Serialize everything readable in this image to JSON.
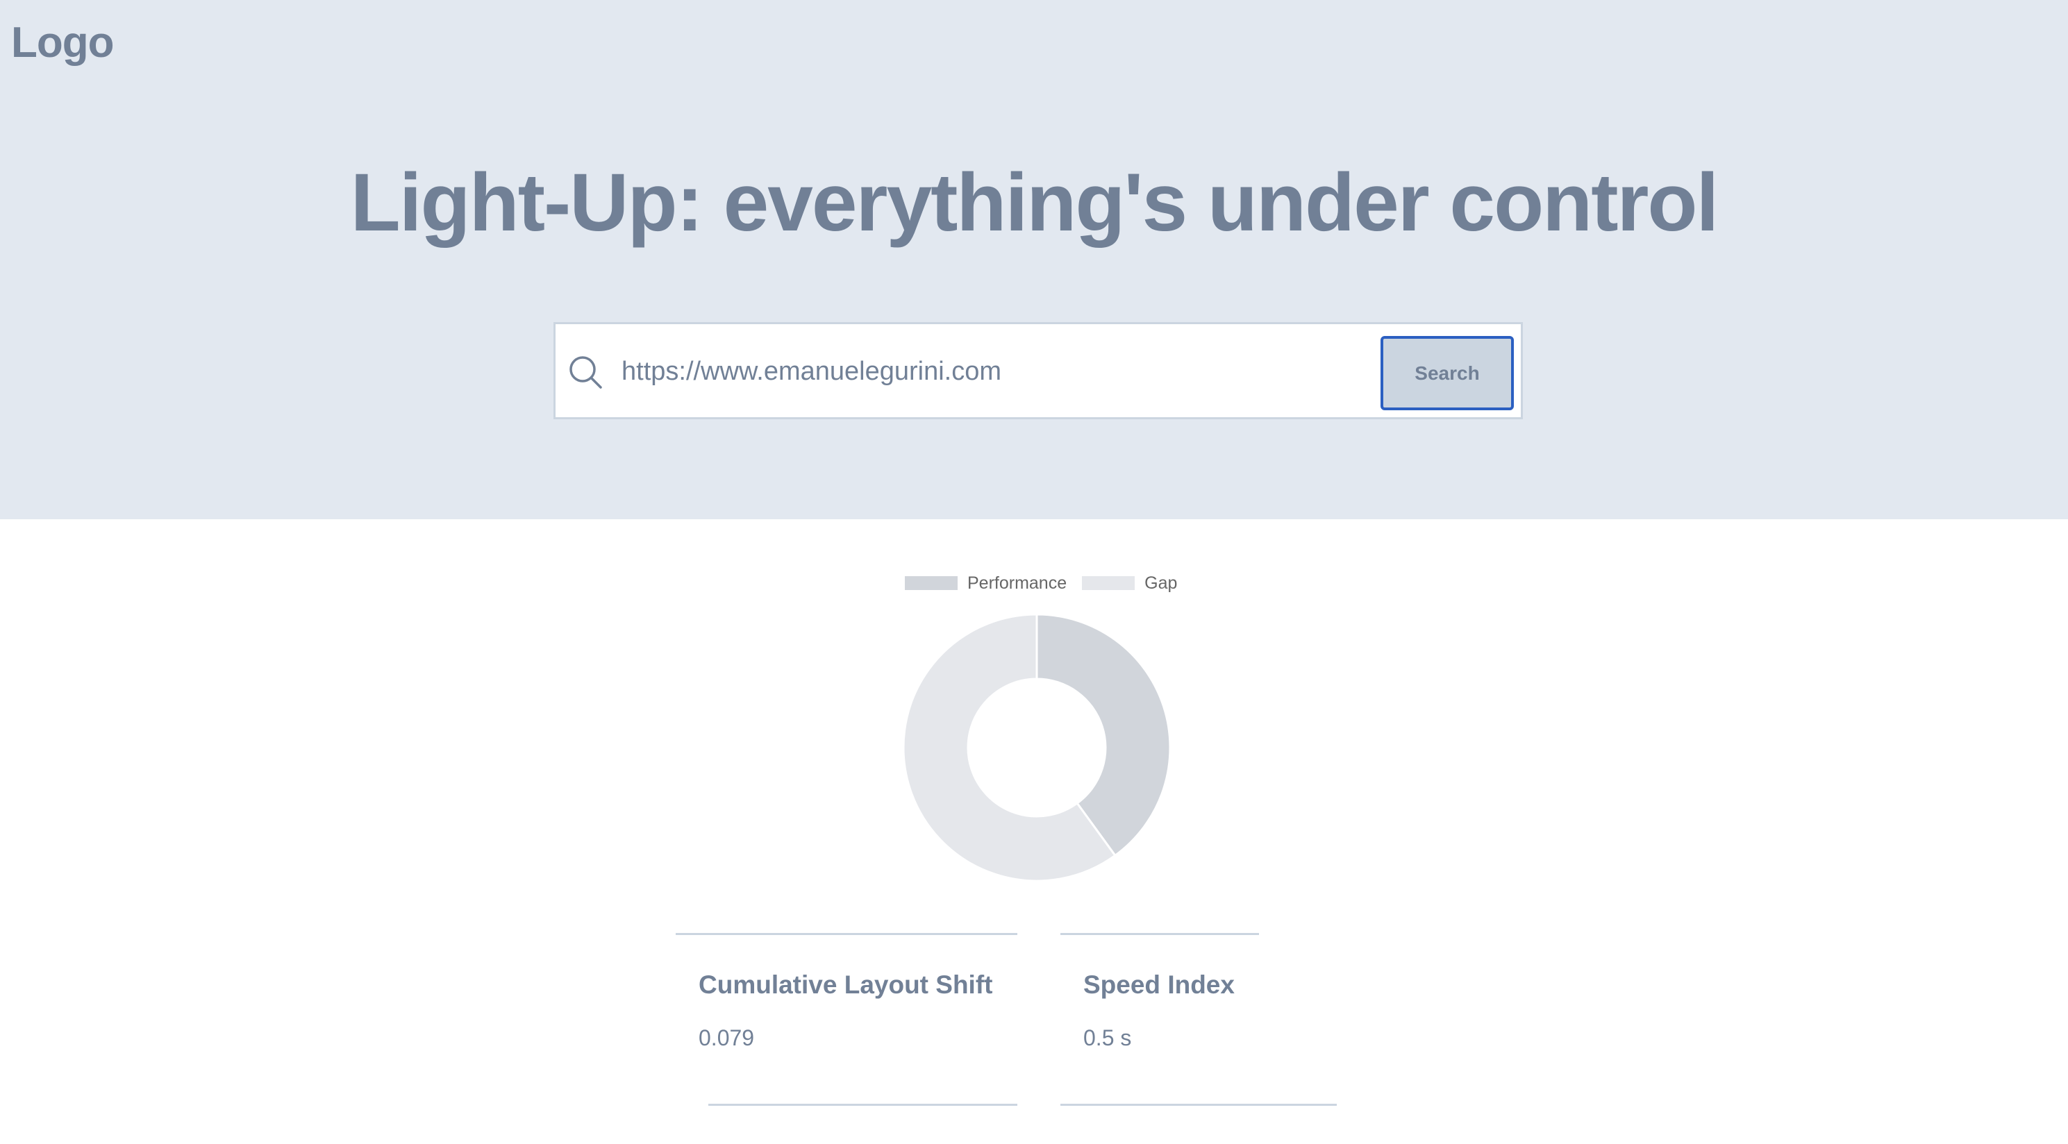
{
  "header": {
    "logo": "Logo",
    "headline": "Light-Up: everything's under control"
  },
  "search": {
    "value": "https://www.emanuelegurini.com",
    "button_label": "Search",
    "icon": "search-icon"
  },
  "chart_data": {
    "type": "pie",
    "variant": "doughnut",
    "legend_position": "top",
    "categories": [
      "Performance",
      "Gap"
    ],
    "values": [
      40,
      60
    ],
    "colors": [
      "#d1d5db",
      "#e5e7eb"
    ]
  },
  "metrics": [
    {
      "title": "Cumulative Layout Shift",
      "value": "0.079"
    },
    {
      "title": "Speed Index",
      "value": "0.5 s"
    }
  ]
}
